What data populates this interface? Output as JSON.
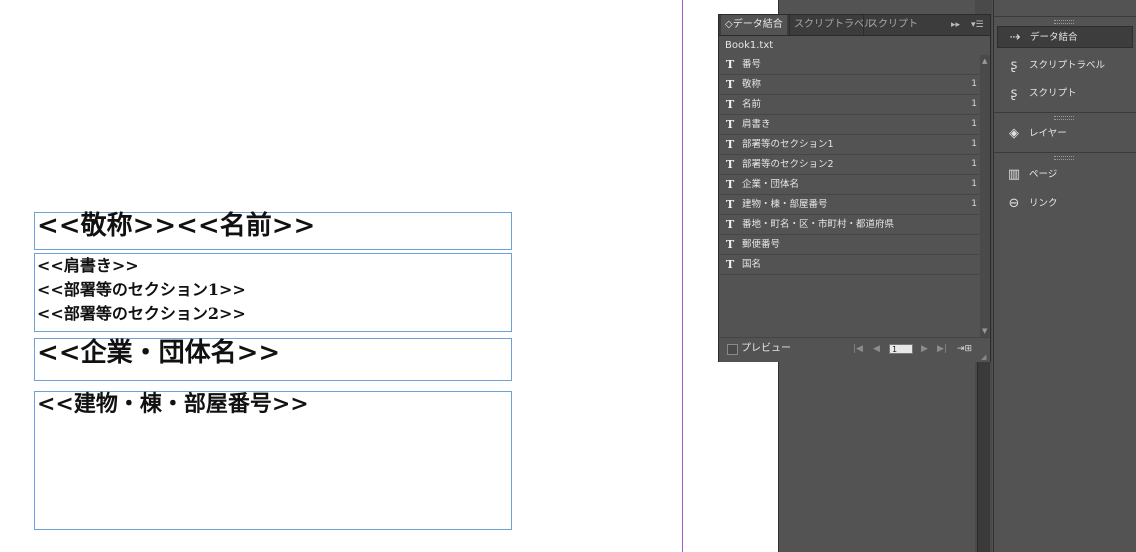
{
  "document": {
    "frame1": "<<敬称>><<名前>>",
    "frame2_lines": [
      "<<肩書き>>",
      "<<部署等のセクション1>>",
      "<<部署等のセクション2>>"
    ],
    "frame3": "<<企業・団体名>>",
    "frame4": "<<建物・棟・部屋番号>>"
  },
  "panel": {
    "tabs": [
      {
        "label": "◇データ結合",
        "active": true
      },
      {
        "label": "スクリプトラベル",
        "active": false
      },
      {
        "label": "スクリプト",
        "active": false
      }
    ],
    "menu_expand": "▸▸",
    "menu_button": "▾☰",
    "source_file": "Book1.txt",
    "field_icon": "T",
    "fields": [
      {
        "name": "番号",
        "count": ""
      },
      {
        "name": "敬称",
        "count": "1"
      },
      {
        "name": "名前",
        "count": "1"
      },
      {
        "name": "肩書き",
        "count": "1"
      },
      {
        "name": "部署等のセクション1",
        "count": "1"
      },
      {
        "name": "部署等のセクション2",
        "count": "1"
      },
      {
        "name": "企業・団体名",
        "count": "1"
      },
      {
        "name": "建物・棟・部屋番号",
        "count": "1"
      },
      {
        "name": "番地・町名・区・市町村・都道府県",
        "count": ""
      },
      {
        "name": "郵便番号",
        "count": ""
      },
      {
        "name": "国名",
        "count": ""
      }
    ],
    "preview_label": "プレビュー",
    "preview_checked": false,
    "record_number": "1",
    "nav": {
      "first": "|◀",
      "prev": "◀",
      "next": "▶",
      "last": "▶|",
      "create": "⇥⊞"
    }
  },
  "dock": {
    "items": [
      {
        "label": "データ結合",
        "icon": "data-merge-icon",
        "glyph": "⇢",
        "selected": true
      },
      {
        "label": "スクリプトラベル",
        "icon": "script-label-icon",
        "glyph": "ʂ",
        "selected": false
      },
      {
        "label": "スクリプト",
        "icon": "script-icon",
        "glyph": "ʂ",
        "selected": false
      },
      {
        "label": "レイヤー",
        "icon": "layers-icon",
        "glyph": "◈",
        "selected": false
      },
      {
        "label": "ページ",
        "icon": "pages-icon",
        "glyph": "▥",
        "selected": false
      },
      {
        "label": "リンク",
        "icon": "links-icon",
        "glyph": "⊖",
        "selected": false
      }
    ]
  }
}
